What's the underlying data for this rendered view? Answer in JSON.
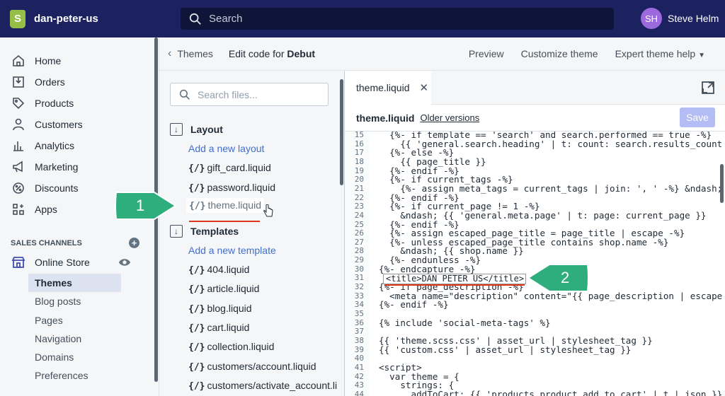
{
  "topbar": {
    "store_name": "dan-peter-us",
    "search_placeholder": "Search",
    "user_initials": "SH",
    "user_name": "Steve Helm"
  },
  "sidebar": {
    "items": [
      {
        "label": "Home",
        "icon": "home-icon"
      },
      {
        "label": "Orders",
        "icon": "orders-icon"
      },
      {
        "label": "Products",
        "icon": "tag-icon"
      },
      {
        "label": "Customers",
        "icon": "person-icon"
      },
      {
        "label": "Analytics",
        "icon": "bar-chart-icon"
      },
      {
        "label": "Marketing",
        "icon": "megaphone-icon"
      },
      {
        "label": "Discounts",
        "icon": "discount-icon"
      },
      {
        "label": "Apps",
        "icon": "apps-icon"
      }
    ],
    "channels_heading": "SALES CHANNELS",
    "online_store": "Online Store",
    "sub_items": [
      "Themes",
      "Blog posts",
      "Pages",
      "Navigation",
      "Domains",
      "Preferences"
    ]
  },
  "header": {
    "back_label": "Themes",
    "edit_prefix": "Edit code for",
    "theme_name": "Debut",
    "preview": "Preview",
    "customize": "Customize theme",
    "expert_help": "Expert theme help"
  },
  "files": {
    "search_placeholder": "Search files...",
    "layout_heading": "Layout",
    "add_layout": "Add a new layout",
    "layout_files": [
      "gift_card.liquid",
      "password.liquid",
      "theme.liquid"
    ],
    "templates_heading": "Templates",
    "add_template": "Add a new template",
    "template_files": [
      "404.liquid",
      "article.liquid",
      "blog.liquid",
      "cart.liquid",
      "collection.liquid",
      "customers/account.liquid",
      "customers/activate_account.li"
    ],
    "file_glyph": "{/}"
  },
  "editor": {
    "tab_name": "theme.liquid",
    "file_title": "theme.liquid",
    "older_versions": "Older versions",
    "save_label": "Save",
    "lines": [
      {
        "n": "15",
        "t": "  {%- if template == 'search' and search.performed == true -%}"
      },
      {
        "n": "16",
        "t": "    {{ 'general.search.heading' | t: count: search.results_count }}"
      },
      {
        "n": "17",
        "t": "  {%- else -%}"
      },
      {
        "n": "18",
        "t": "    {{ page_title }}"
      },
      {
        "n": "19",
        "t": "  {%- endif -%}"
      },
      {
        "n": "20",
        "t": "  {%- if current_tags -%}"
      },
      {
        "n": "21",
        "t": "    {%- assign meta_tags = current_tags | join: ', ' -%} &ndash; {"
      },
      {
        "n": "22",
        "t": "  {%- endif -%}"
      },
      {
        "n": "23",
        "t": "  {%- if current_page != 1 -%}"
      },
      {
        "n": "24",
        "t": "    &ndash; {{ 'general.meta.page' | t: page: current_page }}"
      },
      {
        "n": "25",
        "t": "  {%- endif -%}"
      },
      {
        "n": "26",
        "t": "  {%- assign escaped_page_title = page_title | escape -%}"
      },
      {
        "n": "27",
        "t": "  {%- unless escaped_page_title contains shop.name -%}"
      },
      {
        "n": "28",
        "t": "    &ndash; {{ shop.name }}"
      },
      {
        "n": "29",
        "t": "  {%- endunless -%}"
      },
      {
        "n": "30",
        "t": "{%- endcapture -%}"
      },
      {
        "n": "31",
        "t": ""
      },
      {
        "n": "32",
        "t": "{%- if page_description -%}"
      },
      {
        "n": "33",
        "t": "  <meta name=\"description\" content=\"{{ page_description | escape }}"
      },
      {
        "n": "34",
        "t": "{%- endif -%}"
      },
      {
        "n": "35",
        "t": ""
      },
      {
        "n": "36",
        "t": "{% include 'social-meta-tags' %}"
      },
      {
        "n": "37",
        "t": ""
      },
      {
        "n": "38",
        "t": "{{ 'theme.scss.css' | asset_url | stylesheet_tag }}"
      },
      {
        "n": "39",
        "t": "{{ 'custom.css' | asset_url | stylesheet_tag }}"
      },
      {
        "n": "40",
        "t": ""
      },
      {
        "n": "41",
        "t": "<script>"
      },
      {
        "n": "42",
        "t": "  var theme = {"
      },
      {
        "n": "43",
        "t": "    strings: {"
      },
      {
        "n": "44",
        "t": "      addToCart: {{ 'products.product.add_to_cart' | t | json }},"
      }
    ],
    "highlight_text": "<title>DAN PETER US</title>"
  },
  "callouts": [
    "1",
    "2"
  ]
}
